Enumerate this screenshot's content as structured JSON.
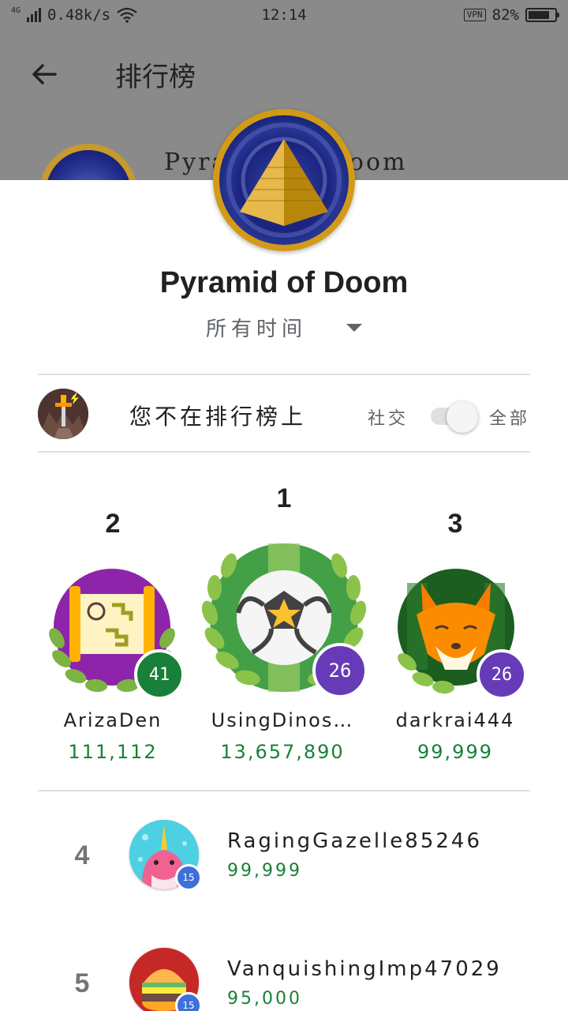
{
  "status_bar": {
    "network_type": "4G",
    "speed": "0.48k/s",
    "time": "12:14",
    "vpn": "VPN",
    "battery": "82%",
    "battery_level": 0.82
  },
  "app_bar": {
    "title": "排行榜",
    "behind_name": "Pyramid of Doom"
  },
  "game": {
    "title": "Pyramid of Doom",
    "period": "所有时间"
  },
  "me": {
    "status": "您不在排行榜上",
    "social_label": "社交",
    "all_label": "全部"
  },
  "podium": [
    {
      "rank": "2",
      "name": "ArizaDen",
      "score": "111,112",
      "level": "41",
      "badge_color": "#188038",
      "avatar_bg": "#8e24aa"
    },
    {
      "rank": "1",
      "name": "UsingDinos…",
      "score": "13,657,890",
      "level": "26",
      "badge_color": "#673ab7",
      "avatar_bg": "#43a047"
    },
    {
      "rank": "3",
      "name": "darkrai444",
      "score": "99,999",
      "level": "26",
      "badge_color": "#673ab7",
      "avatar_bg": "#1b5e20"
    }
  ],
  "list": [
    {
      "rank": "4",
      "name": "RagingGazelle85246",
      "score": "99,999",
      "level": "15",
      "avatar_bg": "#4dd0e1"
    },
    {
      "rank": "5",
      "name": "VanquishingImp47029",
      "score": "95,000",
      "level": "15",
      "avatar_bg": "#c62828"
    }
  ]
}
